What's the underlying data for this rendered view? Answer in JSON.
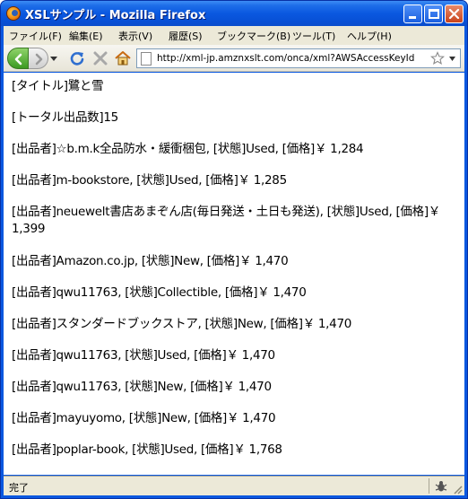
{
  "window": {
    "title": "XSLサンプル - Mozilla Firefox"
  },
  "menu": {
    "items": [
      "ファイル(F)",
      "編集(E)",
      "表示(V)",
      "履歴(S)",
      "ブックマーク(B)",
      "ツール(T)",
      "ヘルプ(H)"
    ]
  },
  "toolbar": {
    "url": "http://xml-jp.amznxslt.com/onca/xml?AWSAccessKeyId"
  },
  "content": {
    "title_line": "[タイトル]鷺と雪",
    "total_line": "[トータル出品数]15",
    "listings": [
      "[出品者]☆b.m.k全品防水・緩衝梱包, [状態]Used, [価格]￥ 1,284",
      "[出品者]m-bookstore, [状態]Used, [価格]￥ 1,285",
      "[出品者]neuewelt書店あまぞん店(毎日発送・土日も発送), [状態]Used, [価格]￥ 1,399",
      "[出品者]Amazon.co.jp, [状態]New, [価格]￥ 1,470",
      "[出品者]qwu11763, [状態]Collectible, [価格]￥ 1,470",
      "[出品者]スタンダードブックストア, [状態]New, [価格]￥ 1,470",
      "[出品者]qwu11763, [状態]Used, [価格]￥ 1,470",
      "[出品者]qwu11763, [状態]New, [価格]￥ 1,470",
      "[出品者]mayuyomo, [状態]New, [価格]￥ 1,470",
      "[出品者]poplar-book, [状態]Used, [価格]￥ 1,768"
    ]
  },
  "status": {
    "text": "完了"
  },
  "colors": {
    "titlebar": "#0a58e0",
    "chrome": "#ece9d8",
    "back_button": "#3c9a22"
  }
}
